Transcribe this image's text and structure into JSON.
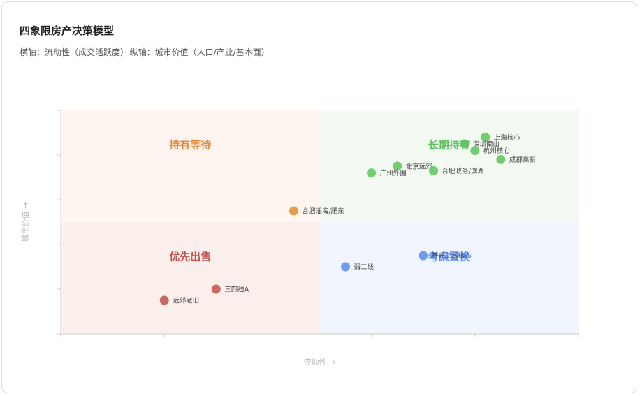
{
  "chart_data": {
    "type": "scatter",
    "title": "四象限房产决策模型",
    "subtitle": "横轴：流动性（成交活跃度）· 纵轴：城市价值（人口/产业/基本面）",
    "xlabel": "流动性 →",
    "ylabel": "城市价值 →",
    "xlim": [
      0,
      10
    ],
    "ylim": [
      0,
      10
    ],
    "grid": false,
    "quadrants": [
      {
        "name": "持有等待",
        "position": "top-left",
        "color": "#e8892f",
        "bg": "#fff5f0"
      },
      {
        "name": "长期持有",
        "position": "top-right",
        "color": "#5cc35c",
        "bg": "#f2faf2"
      },
      {
        "name": "优先出售",
        "position": "bottom-left",
        "color": "#c0504d",
        "bg": "#fbefeb"
      },
      {
        "name": "考虑置换",
        "position": "bottom-right",
        "color": "#5b8def",
        "bg": "#f1f5fd"
      }
    ],
    "points": [
      {
        "label": "上海核心",
        "x": 8.2,
        "y": 8.8,
        "quadrant": "长期持有"
      },
      {
        "label": "深圳南山",
        "x": 7.8,
        "y": 8.5,
        "quadrant": "长期持有"
      },
      {
        "label": "杭州核心",
        "x": 8.0,
        "y": 8.2,
        "quadrant": "长期持有"
      },
      {
        "label": "成都高新",
        "x": 8.5,
        "y": 7.8,
        "quadrant": "长期持有"
      },
      {
        "label": "北京远郊",
        "x": 6.5,
        "y": 7.5,
        "quadrant": "长期持有"
      },
      {
        "label": "合肥政务/滨湖",
        "x": 7.2,
        "y": 7.3,
        "quadrant": "长期持有"
      },
      {
        "label": "广州外围",
        "x": 6.0,
        "y": 7.2,
        "quadrant": "长期持有"
      },
      {
        "label": "合肥瑶海/肥东",
        "x": 4.5,
        "y": 5.5,
        "quadrant": "持有等待"
      },
      {
        "label": "普通二线核心",
        "x": 7.0,
        "y": 3.5,
        "quadrant": "考虑置换"
      },
      {
        "label": "弱二线",
        "x": 5.5,
        "y": 3.0,
        "quadrant": "考虑置换"
      },
      {
        "label": "三四线A",
        "x": 3.0,
        "y": 2.0,
        "quadrant": "优先出售"
      },
      {
        "label": "远郊老旧",
        "x": 2.0,
        "y": 1.5,
        "quadrant": "优先出售"
      }
    ]
  }
}
